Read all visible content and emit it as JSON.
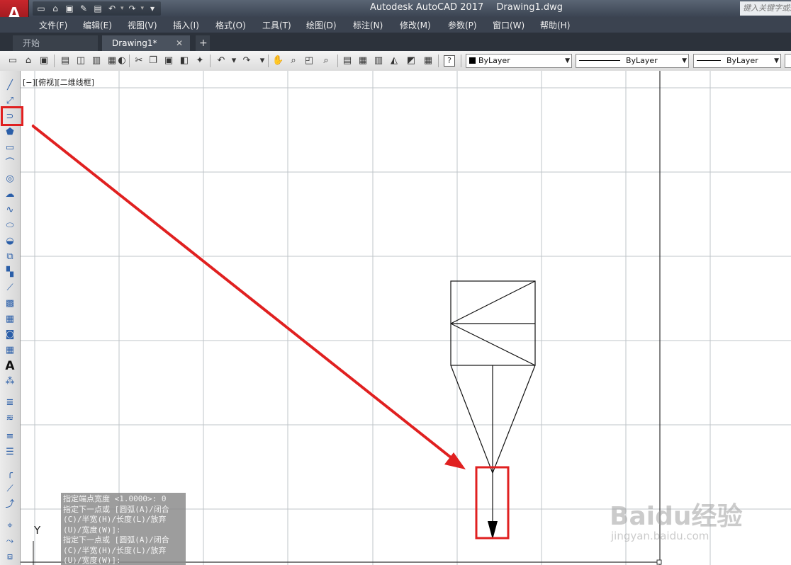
{
  "app": {
    "title": "Autodesk AutoCAD 2017",
    "document": "Drawing1.dwg",
    "logo_letter": "A",
    "search_placeholder": "键入关键字或短语"
  },
  "menu": [
    "文件(F)",
    "编辑(E)",
    "视图(V)",
    "插入(I)",
    "格式(O)",
    "工具(T)",
    "绘图(D)",
    "标注(N)",
    "修改(M)",
    "参数(P)",
    "窗口(W)",
    "帮助(H)"
  ],
  "tabs": {
    "start": "开始",
    "active": "Drawing1*",
    "close": "✕",
    "add": "+"
  },
  "properties": {
    "color": "ByLayer",
    "linetype": "ByLayer",
    "lineweight": "ByLayer"
  },
  "viewport_label": "[−][俯视][二维线框]",
  "axis_label": "Y",
  "command_history": [
    "指定端点宽度 <1.0000>: 0",
    "指定下一点或 [圆弧(A)/闭合(C)/半宽(H)/长度(L)/放弃(U)/宽度(W)]:",
    "指定下一点或 [圆弧(A)/闭合(C)/半宽(H)/长度(L)/放弃(U)/宽度(W)]:"
  ],
  "watermark": {
    "brand": "Baidu经验",
    "url": "jingyan.baidu.com"
  },
  "colors": {
    "highlight": "#e02020",
    "titlebar": "#3b4452",
    "menubar": "#3b4350"
  }
}
